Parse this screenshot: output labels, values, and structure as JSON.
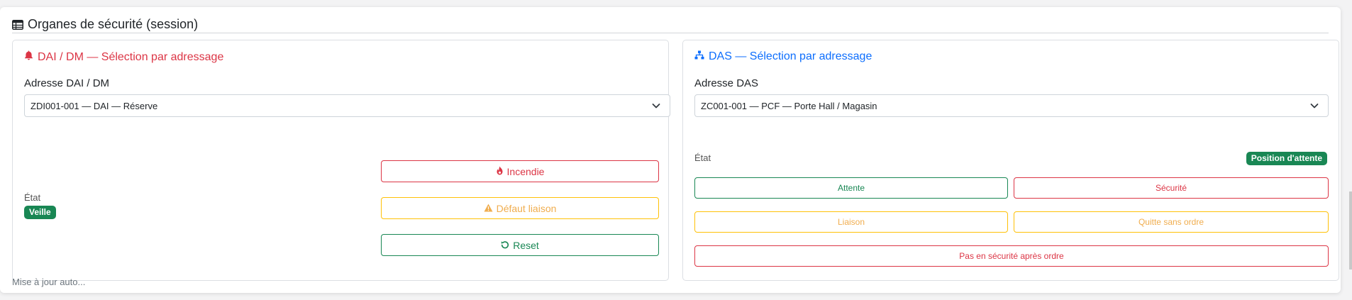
{
  "header": {
    "title": "Organes de sécurité (session)",
    "icon": "table-icon"
  },
  "dai": {
    "title": "DAI / DM — Sélection par adressage",
    "icon": "bell-icon",
    "address_label": "Adresse DAI / DM",
    "address_value": "ZDI001-001 — DAI — Réserve",
    "state_label": "État",
    "state_badge": "Veille",
    "buttons": {
      "incendie": "Incendie",
      "defaut_liaison": "Défaut liaison",
      "reset": "Reset"
    }
  },
  "das": {
    "title": "DAS — Sélection par adressage",
    "icon": "sitemap-icon",
    "address_label": "Adresse DAS",
    "address_value": "ZC001-001 — PCF — Porte Hall / Magasin",
    "state_label": "État",
    "state_badge": "Position d'attente",
    "buttons": {
      "attente": "Attente",
      "securite": "Sécurité",
      "liaison": "Liaison",
      "quitte_sans_ordre": "Quitte sans ordre",
      "pas_en_securite": "Pas en sécurité après ordre"
    }
  },
  "footer": {
    "text": "Mise à jour auto..."
  },
  "colors": {
    "danger": "#dc3545",
    "primary": "#0d6efd",
    "success": "#198754",
    "warning": "#ffc107"
  }
}
